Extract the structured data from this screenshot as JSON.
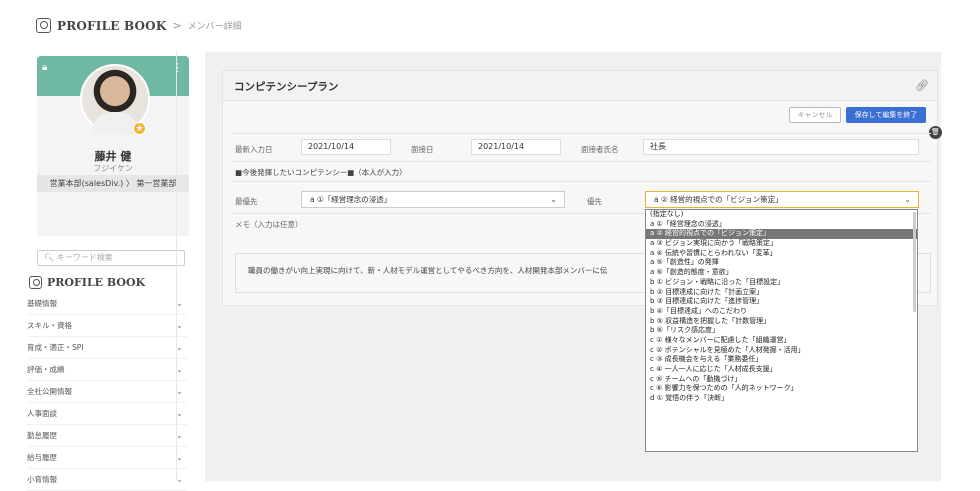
{
  "header": {
    "brand": "PROFILE BOOK",
    "separator": ">",
    "crumb": "メンバー詳細"
  },
  "profile": {
    "name": "藤井 健",
    "kana": "フジイケン",
    "department": "営業本部(salesDiv.) 〉 第一営業部"
  },
  "sidebar": {
    "search_placeholder": "キーワード検索",
    "brand": "PROFILE BOOK",
    "items": [
      {
        "label": "基礎情報"
      },
      {
        "label": "スキル・資格"
      },
      {
        "label": "育成・適正・SPI"
      },
      {
        "label": "評価・成績"
      },
      {
        "label": "全社公開情報"
      },
      {
        "label": "人事面談"
      },
      {
        "label": "勤怠履歴"
      },
      {
        "label": "給与履歴"
      },
      {
        "label": "小育情報"
      }
    ]
  },
  "panel": {
    "title": "コンピテンシープラン",
    "cancel_label": "キャンセル",
    "save_label": "保存して編集を終了",
    "updated_label": "最新入力日",
    "updated_value": "2021/10/14",
    "interview_date_label": "面接日",
    "interview_date_value": "2021/10/14",
    "interviewer_label": "面接者氏名",
    "interviewer_value": "社長",
    "competency_heading": "■今後発揮したいコンピテンシー■（本人が入力）",
    "top_priority_label": "最優先",
    "top_priority_value": "a ①「経営理念の浸透」",
    "priority_label": "優先",
    "priority_value": "a ② 経営的視点での「ビジョン策定」",
    "memo_label": "メモ（入力は任意）",
    "memo_text": "職員の働きがい向上実現に向けて、新・人材モデル運営としてやるべき方向を、人材開発本部メンバーに伝"
  },
  "dropdown": {
    "options": [
      "(指定なし)",
      "a ①「経営理念の浸透」",
      "a ② 経営的視点での「ビジョン策定」",
      "a ③ ビジョン実現に向かう「戦略策定」",
      "a ④ 伝統や習慣にとらわれない「変革」",
      "a ⑤「創造性」の発揮",
      "a ⑥「創造的態度・意欲」",
      "b ① ビジョン・戦略に沿った「目標設定」",
      "b ② 目標達成に向けた「計画立案」",
      "b ③ 目標達成に向けた「進捗管理」",
      "b ④「目標達成」へのこだわり",
      "b ⑤ 収益構造を把握した「計数管理」",
      "b ⑥「リスク感応度」",
      "c ① 様々なメンバーに配慮した「組織運営」",
      "c ② ポテンシャルを見極めた「人材発掘・活用」",
      "c ③ 成長機会を与える「業務委任」",
      "c ④ 一人一人に応じた「人材成長支援」",
      "c ⑤ チームへの「動機づけ」",
      "c ⑥ 影響力を保つための「人的ネットワーク」",
      "d ① 覚悟の伴う「決断」"
    ],
    "selected_index": 2
  },
  "colors": {
    "accent": "#3b6fd4",
    "profile_bg": "#6fb9a4",
    "badge": "#f2b233",
    "focus_border": "#e3b43a"
  }
}
